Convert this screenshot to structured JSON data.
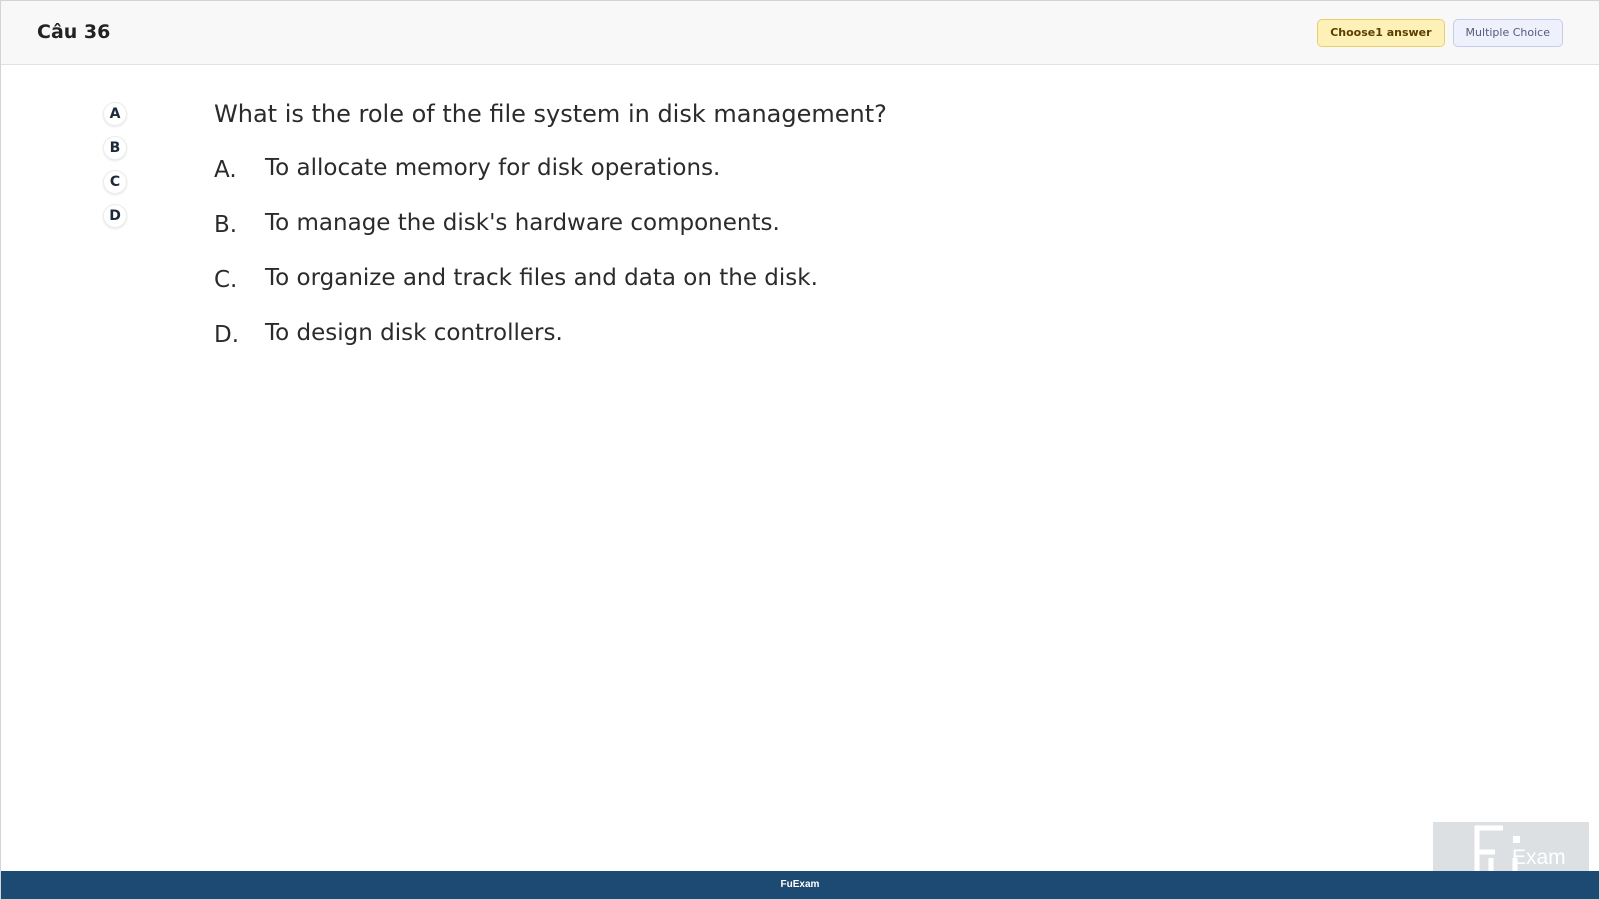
{
  "header": {
    "question_number": "Câu 36",
    "choose_badge": "Choose1 answer",
    "type_badge": "Multiple Choice"
  },
  "answer_bubbles": [
    "A",
    "B",
    "C",
    "D"
  ],
  "question": {
    "text": "What is the role of the file system in disk management?",
    "options": [
      {
        "letter": "A.",
        "text": "To allocate memory for disk operations."
      },
      {
        "letter": "B.",
        "text": "To manage the disk's hardware components."
      },
      {
        "letter": "C.",
        "text": "To organize and track files and data on the disk."
      },
      {
        "letter": "D.",
        "text": "To design disk controllers."
      }
    ]
  },
  "footer": {
    "label": "FuExam"
  },
  "watermark": {
    "text": "Exam"
  },
  "colors": {
    "footer_bg": "#1d4a72",
    "choose_badge_bg": "#fdf1b8",
    "type_badge_bg": "#eef0fb"
  }
}
